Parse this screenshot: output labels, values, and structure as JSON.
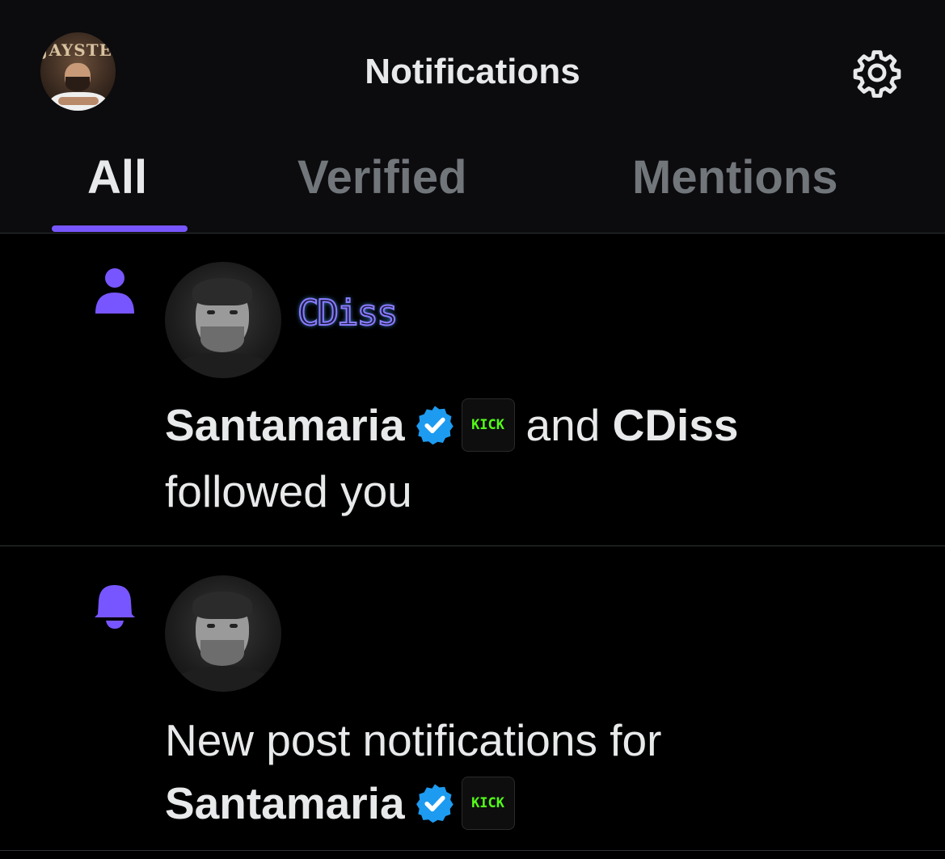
{
  "header": {
    "title": "Notifications",
    "avatar_brand": "JAYSTEE"
  },
  "tabs": [
    {
      "label": "All",
      "active": true
    },
    {
      "label": "Verified",
      "active": false
    },
    {
      "label": "Mentions",
      "active": false
    }
  ],
  "notifications": [
    {
      "type_icon": "person-icon",
      "display_name_art": "CDiss",
      "line1_name1": "Santamaria",
      "line1_conj": "and",
      "line1_name2": "CDiss",
      "line2": "followed you",
      "kick_badge": "KICK"
    },
    {
      "type_icon": "bell-icon",
      "line1": "New post notifications for",
      "line2_name": "Santamaria",
      "kick_badge": "KICK"
    }
  ],
  "colors": {
    "accent": "#7856ff",
    "verified": "#1d9bf0",
    "kick_green": "#53fc18",
    "muted_tab": "#71767b"
  }
}
